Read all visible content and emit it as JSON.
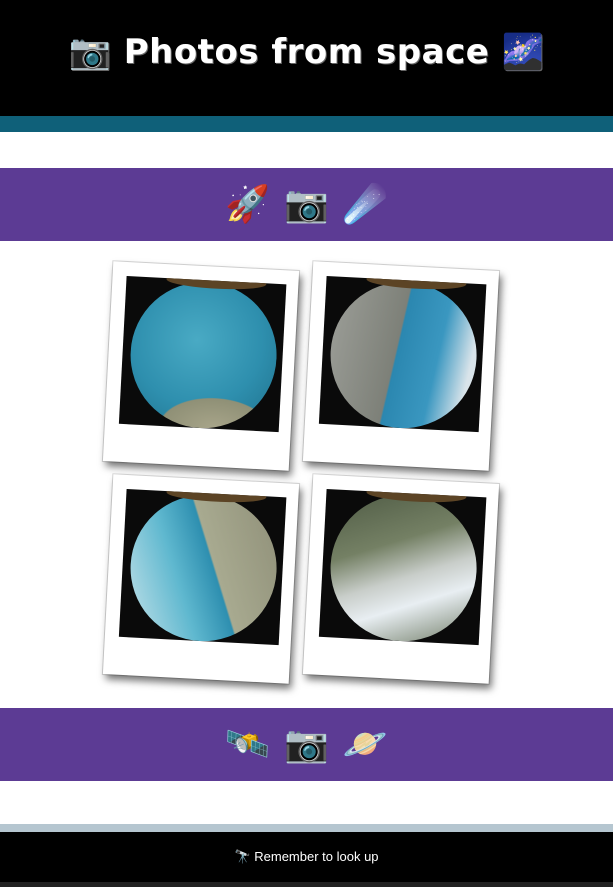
{
  "header": {
    "title": "📷 Photos from space 🌌"
  },
  "top_band": {
    "icons": [
      "🚀",
      "📷",
      "☄️"
    ]
  },
  "gallery": {
    "photos": [
      {
        "icon": "earth-photo-1"
      },
      {
        "icon": "earth-photo-2"
      },
      {
        "icon": "earth-photo-3"
      },
      {
        "icon": "earth-photo-4"
      }
    ]
  },
  "bottom_band": {
    "icons": [
      "🛰️",
      "📷",
      "🪐"
    ]
  },
  "footer": {
    "text": "🔭 Remember to look up"
  },
  "colors": {
    "header_bg": "#000000",
    "teal_bar": "#0f6079",
    "purple_band": "#5c3b94",
    "footer_bg": "#000000",
    "grey_bar": "#b5c6d0"
  }
}
